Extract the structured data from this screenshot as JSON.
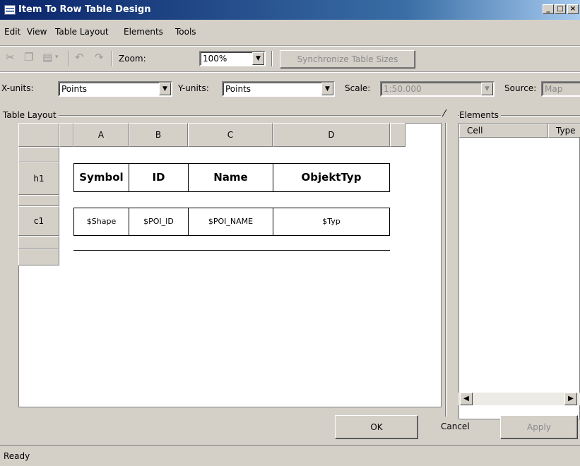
{
  "window": {
    "title": "Item To Row Table Design"
  },
  "menu": [
    "Edit",
    "View",
    "Table Layout",
    "Elements",
    "Tools"
  ],
  "toolbar": {
    "zoom_label": "Zoom:",
    "zoom_value": "100%",
    "sync_button": "Synchronize Table Sizes",
    "icons": [
      "cut-icon",
      "copy-icon",
      "paste-icon",
      "undo-icon",
      "redo-icon"
    ]
  },
  "units": {
    "x_label": "X-units:",
    "x_value": "Points",
    "y_label": "Y-units:",
    "y_value": "Points",
    "scale_label": "Scale:",
    "scale_value": "1:50.000",
    "source_label": "Source:",
    "source_value": "Map"
  },
  "table_layout": {
    "panel_label": "Table Layout",
    "columns": [
      "A",
      "B",
      "C",
      "D"
    ],
    "rows": [
      "h1",
      "c1"
    ],
    "header_cells": [
      "Symbol",
      "ID",
      "Name",
      "ObjektTyp"
    ],
    "content_cells": [
      "$Shape",
      "$POI_ID",
      "$POI_NAME",
      "$Typ"
    ]
  },
  "elements": {
    "panel_label": "Elements",
    "col_cell": "Cell",
    "col_type": "Type"
  },
  "buttons": {
    "ok": "OK",
    "cancel": "Cancel",
    "apply": "Apply"
  },
  "status": {
    "text": "Ready"
  }
}
